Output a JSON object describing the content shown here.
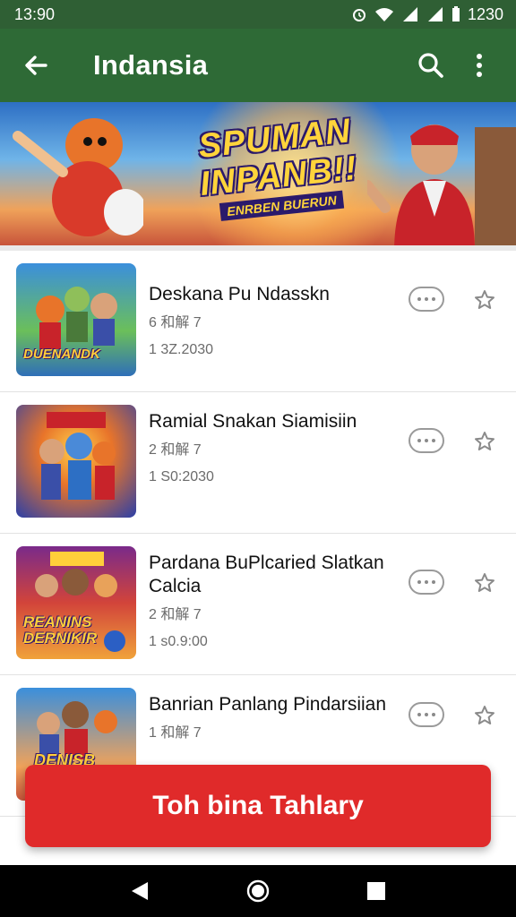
{
  "status_bar": {
    "time": "13:90",
    "right_time": "1230"
  },
  "app_bar": {
    "title": "Indansia"
  },
  "banner": {
    "headline_line1": "SPUMAN",
    "headline_line2": "INPANB!!",
    "subtitle": "ENRBEN BUERUN"
  },
  "list": [
    {
      "title": "Deskana Pu Ndasskn",
      "meta": "6 和解 7",
      "time": "1 3Z.2030",
      "thumb_logo": "DUENANDK"
    },
    {
      "title": "Ramial Snakan Siamisiin",
      "meta": "2 和解 7",
      "time": "1 S0:2030",
      "thumb_logo": ""
    },
    {
      "title": "Pardana BuPlcaried Slatkan Calcia",
      "meta": "2 和解 7",
      "time": "1 s0.9:00",
      "thumb_logo": "REANINS DERNIKIR"
    },
    {
      "title": "Banrian Panlang Pindarsiian",
      "meta": "1 和解 7",
      "time": "",
      "thumb_logo": "DENISB"
    }
  ],
  "cta": {
    "label": "Toh bina Tahlary"
  },
  "colors": {
    "app_bar": "#2e6a36",
    "status_bar": "#2f5f34",
    "cta": "#e02a2a"
  },
  "icons": [
    "back-arrow-icon",
    "search-icon",
    "more-vert-icon",
    "more-horiz-icon",
    "star-outline-icon",
    "nav-back-icon",
    "nav-home-icon",
    "nav-recents-icon"
  ]
}
